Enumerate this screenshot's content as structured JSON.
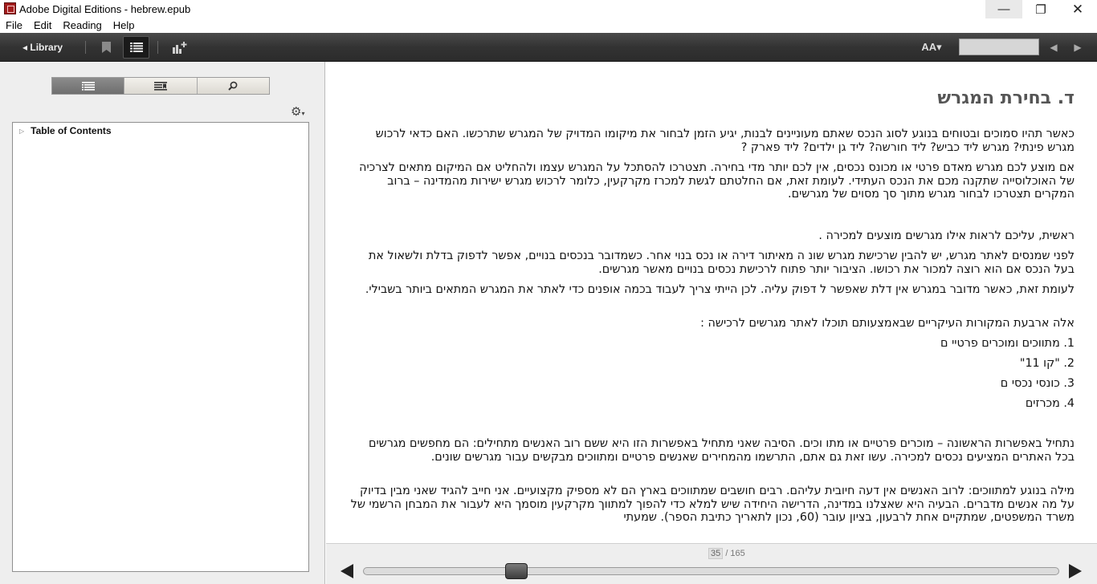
{
  "window": {
    "title": "Adobe Digital Editions - hebrew.epub",
    "minimize": "—",
    "maximize": "❐",
    "close": "✕"
  },
  "menu": [
    "File",
    "Edit",
    "Reading",
    "Help"
  ],
  "toolbar": {
    "library_label": "◂ Library",
    "font_size_label": "AA▾",
    "prev_page": "◀",
    "next_page": "▶"
  },
  "left_panel": {
    "tabs": [
      "toc-icon",
      "bookmarks-icon",
      "search-icon"
    ],
    "active_tab": 0,
    "settings_icon": "⚙",
    "settings_caret": "▾",
    "toc_root": "Table of Contents"
  },
  "content": {
    "heading": "ד. בחירת המגרש",
    "paragraphs": [
      "כאשר תהיו סמוכים ובטוחים בנוגע לסוג הנכס שאתם מעוניינים לבנות, יגיע הזמן לבחור את מיקומו המדויק של המגרש שתרכשו. האם כדאי לרכוש מגרש פינתי? מגרש ליד כביש? ליד חורשה? ליד גן ילדים? ליד פארק ?",
      "אם מוצע לכם מגרש מאדם פרטי או מכונס נכסים, אין לכם יותר מדי בחירה. תצטרכו להסתכל על המגרש עצמו ולהחליט אם המיקום מתאים לצרכיה של האוכלוסייה שתקנה מכם את הנכס העתידי. לעומת זאת, אם החלטתם לגשת למכרז מקרקעין, כלומר לרכוש מגרש ישירות מהמדינה – ברוב המקרים תצטרכו לבחור מגרש מתוך סך מסוים של מגרשים.",
      "ראשית, עליכם לראות אילו מגרשים מוצעים למכירה .",
      "לפני שמנסים לאתר מגרש, יש להבין שרכישת מגרש שונ ה מאיתור דירה או נכס בנוי אחר. כשמדובר בנכסים בנויים, אפשר לדפוק בדלת ולשאול את בעל הנכס אם הוא רוצה למכור את רכושו. הציבור יותר פתוח לרכישת נכסים בנויים מאשר מגרשים.",
      "לעומת זאת, כאשר מדובר במגרש אין דלת שאפשר ל דפוק עליה. לכן הייתי צריך לעבוד בכמה אופנים כדי לאתר את המגרש המתאים ביותר בשבילי.",
      "אלה ארבעת המקורות העיקריים שבאמצעותם תוכלו לאתר מגרשים לרכישה :",
      "1. מתווכים ומוכרים פרטיי ם",
      "2. \"קו 11\"",
      "3. כונסי נכסי ם",
      "4. מכרזים",
      "נתחיל באפשרות הראשונה – מוכרים פרטיים או מתו וכים. הסיבה שאני מתחיל באפשרות הזו היא ששם רוב האנשים מתחילים: הם מחפשים מגרשים בכל האתרים המציעים נכסים למכירה. עשו זאת גם אתם, התרשמו מהמחירים שאנשים פרטיים ומתווכים מבקשים עבור מגרשים שונים.",
      "מילה בנוגע למתווכים: לרוב האנשים אין דעה חיובית עליהם. רבים חושבים שמתווכים בארץ הם לא מספיק מקצועיים. אני חייב להגיד שאני מבין בדיוק על מה אנשים מדברים. הבעיה היא שאצלנו במדינה, הדרישה היחידה שיש למלא כדי להפוך למתווך מקרקעין מוסמך היא לעבור את המבחן הרשמי של משרד המשפטים, שמתקיים אחת לרבעון, בציון עובר (60, נכון לתאריך כתיבת הספר). שמעתי"
    ]
  },
  "footer": {
    "current_page": "35",
    "total_pages": "/ 165",
    "progress_fraction": 0.21
  }
}
